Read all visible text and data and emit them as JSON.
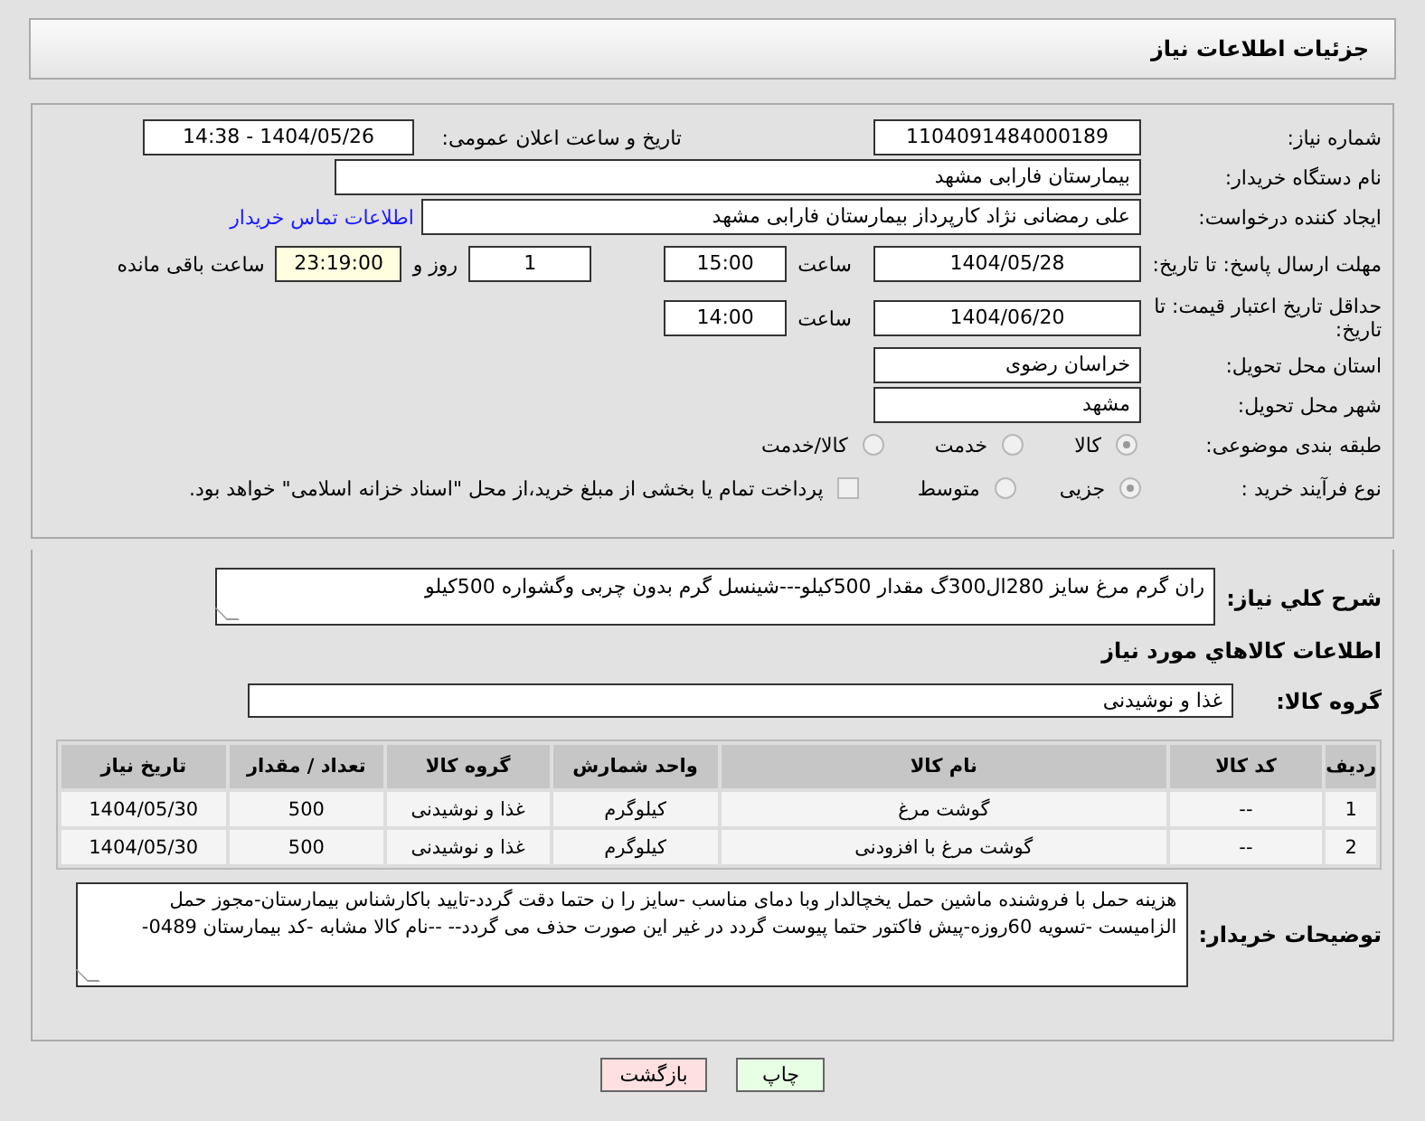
{
  "header": {
    "title": "جزئیات اطلاعات نیاز"
  },
  "details": {
    "need_number": {
      "label": "شماره نیاز:",
      "value": "1104091484000189"
    },
    "announce": {
      "label": "تاریخ و ساعت اعلان عمومی:",
      "value": "1404/05/26 - 14:38"
    },
    "buyer_org": {
      "label": "نام دستگاه خریدار:",
      "value": "بیمارستان فارابی مشهد"
    },
    "requester": {
      "label": "ایجاد کننده درخواست:",
      "value": "علی رمضانی نژاد کارپرداز بیمارستان فارابی مشهد",
      "link": "اطلاعات تماس خریدار"
    },
    "reply_deadline": {
      "label": "مهلت ارسال پاسخ: تا تاریخ:",
      "date": "1404/05/28",
      "time_label": "ساعت",
      "time": "15:00",
      "days": "1",
      "days_label": "روز و",
      "remaining": "23:19:00",
      "remaining_label": "ساعت باقی مانده"
    },
    "price_validity": {
      "label": "حداقل تاریخ اعتبار قیمت: تا تاریخ:",
      "date": "1404/06/20",
      "time_label": "ساعت",
      "time": "14:00"
    },
    "province": {
      "label": "استان محل تحویل:",
      "value": "خراسان رضوی"
    },
    "city": {
      "label": "شهر محل تحویل:",
      "value": "مشهد"
    },
    "category": {
      "label": "طبقه بندی موضوعی:",
      "options": [
        {
          "label": "کالا",
          "selected": true
        },
        {
          "label": "خدمت",
          "selected": false
        },
        {
          "label": "کالا/خدمت",
          "selected": false
        }
      ]
    },
    "purchase_type": {
      "label": "نوع فرآیند خرید :",
      "options": [
        {
          "label": "جزیی",
          "selected": true
        },
        {
          "label": "متوسط",
          "selected": false
        }
      ],
      "treasury": {
        "label": "پرداخت تمام یا بخشی از مبلغ خرید،از محل \"اسناد خزانه اسلامی\" خواهد بود.",
        "checked": false
      }
    }
  },
  "description": {
    "label": "شرح کلي نياز:",
    "value": "ران گرم مرغ سایز 280ال300گ مقدار 500کیلو---شینسل گرم بدون چربی وگشواره 500کیلو"
  },
  "items_title": "اطلاعات كالاهاي مورد نياز",
  "goods_group": {
    "label": "گروه کالا:",
    "value": "غذا و نوشیدنی"
  },
  "table": {
    "columns": [
      "ردیف",
      "کد کالا",
      "نام کالا",
      "واحد شمارش",
      "گروه کالا",
      "تعداد / مقدار",
      "تاریخ نیاز"
    ],
    "rows": [
      [
        "1",
        "--",
        "گوشت مرغ",
        "کیلوگرم",
        "غذا و نوشیدنی",
        "500",
        "1404/05/30"
      ],
      [
        "2",
        "--",
        "گوشت مرغ با افزودنی",
        "کیلوگرم",
        "غذا و نوشیدنی",
        "500",
        "1404/05/30"
      ]
    ]
  },
  "buyer_notes": {
    "label": "توضیحات خریدار:",
    "value": "هزینه حمل با فروشنده ماشین حمل یخچالدار وبا دمای مناسب -سایز را ن حتما دقت گردد-تایید باکارشناس بیمارستان-مجوز حمل الزامیست -تسویه 60روزه-پیش فاکتور حتما پیوست گردد در غیر این صورت حذف می گردد-- --نام کالا مشابه -کد بیمارستان 0489-"
  },
  "buttons": [
    {
      "label": "چاپ",
      "kind": "print"
    },
    {
      "label": "بازگشت",
      "kind": "back"
    }
  ]
}
